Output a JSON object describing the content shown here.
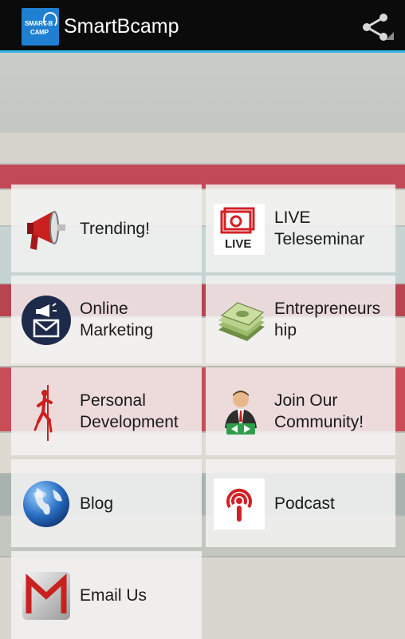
{
  "app": {
    "title": "SmartBcamp",
    "logo_text_line1": "SMART-B",
    "logo_text_line2": "CAMP"
  },
  "actions": {
    "share_icon": "share-icon"
  },
  "colors": {
    "actionbar_bg": "#0b0b0b",
    "accent_line": "#33b5e5",
    "logo_bg": "#1f7fd1",
    "tile_bg": "#f2f2f2"
  },
  "menu": [
    {
      "label": "Trending!",
      "icon": "megaphone-icon"
    },
    {
      "label": "LIVE Teleseminar",
      "icon": "live-icon"
    },
    {
      "label": "Online Marketing",
      "icon": "email-megaphone-icon"
    },
    {
      "label": "Entrepreneurs hip",
      "icon": "money-stack-icon"
    },
    {
      "label": "Personal Development",
      "icon": "climber-icon"
    },
    {
      "label": "Join Our Community!",
      "icon": "businessman-icon"
    },
    {
      "label": "Blog",
      "icon": "globe-icon"
    },
    {
      "label": "Podcast",
      "icon": "podcast-icon"
    },
    {
      "label": "Email Us",
      "icon": "gmail-icon"
    }
  ]
}
